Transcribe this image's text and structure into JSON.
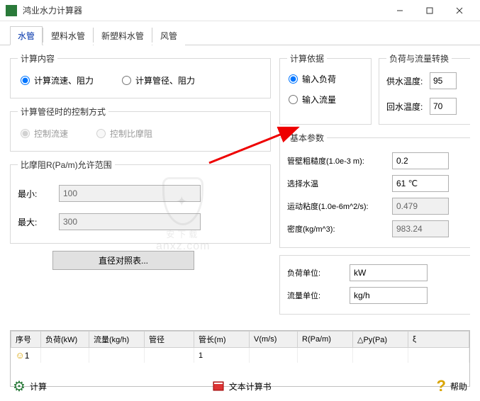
{
  "window": {
    "title": "鸿业水力计算器"
  },
  "tabs": [
    "水管",
    "塑料水管",
    "新塑料水管",
    "风管"
  ],
  "active_tab": 0,
  "calc_content": {
    "legend": "计算内容",
    "opt1": "计算流速、阻力",
    "opt2": "计算管径、阻力",
    "selected": 0
  },
  "diameter_ctrl": {
    "legend": "计算管径时的控制方式",
    "opt1": "控制流速",
    "opt2": "控制比摩阻",
    "enabled": false
  },
  "range": {
    "legend": "比摩阻R(Pa/m)允许范围",
    "min_label": "最小:",
    "min_value": "100",
    "max_label": "最大:",
    "max_value": "300"
  },
  "diameter_table_btn": "直径对照表...",
  "basis": {
    "legend": "计算依据",
    "opt1": "输入负荷",
    "opt2": "输入流量",
    "selected": 0
  },
  "conversion": {
    "legend": "负荷与流量转换",
    "supply_label": "供水温度:",
    "supply_value": "95",
    "return_label": "回水温度:",
    "return_value": "70"
  },
  "basic": {
    "legend": "基本参数",
    "roughness_label": "管壁粗糙度(1.0e-3 m):",
    "roughness_value": "0.2",
    "watertemp_label": "选择水温",
    "watertemp_value": "61 ℃",
    "viscosity_label": "运动粘度(1.0e-6m^2/s):",
    "viscosity_value": "0.479",
    "density_label": "密度(kg/m^3):",
    "density_value": "983.24"
  },
  "units": {
    "load_label": "负荷单位:",
    "load_value": "kW",
    "flow_label": "流量单位:",
    "flow_value": "kg/h"
  },
  "table": {
    "headers": [
      "序号",
      "负荷(kW)",
      "流量(kg/h)",
      "管径",
      "管长(m)",
      "V(m/s)",
      "R(Pa/m)",
      "△Py(Pa)",
      "ξ"
    ],
    "row": {
      "seq": "1",
      "length": "1"
    }
  },
  "bottom": {
    "calc": "计算",
    "text_report": "文本计算书",
    "help": "帮助"
  },
  "watermark": {
    "main": "安下载",
    "sub": "anxz.com"
  }
}
